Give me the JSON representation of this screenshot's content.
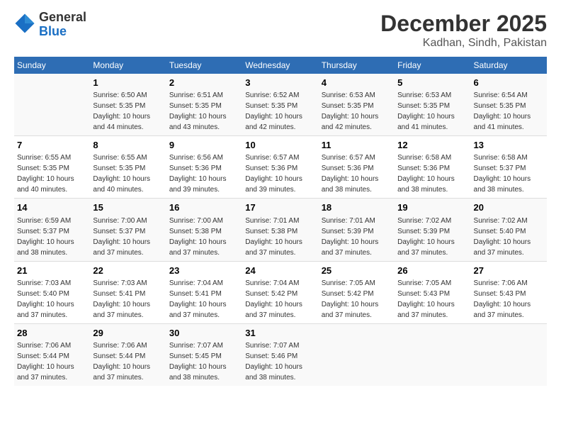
{
  "logo": {
    "general": "General",
    "blue": "Blue"
  },
  "title": "December 2025",
  "subtitle": "Kadhan, Sindh, Pakistan",
  "weekdays": [
    "Sunday",
    "Monday",
    "Tuesday",
    "Wednesday",
    "Thursday",
    "Friday",
    "Saturday"
  ],
  "weeks": [
    [
      {
        "day": "",
        "sunrise": "",
        "sunset": "",
        "daylight": ""
      },
      {
        "day": "1",
        "sunrise": "Sunrise: 6:50 AM",
        "sunset": "Sunset: 5:35 PM",
        "daylight": "Daylight: 10 hours and 44 minutes."
      },
      {
        "day": "2",
        "sunrise": "Sunrise: 6:51 AM",
        "sunset": "Sunset: 5:35 PM",
        "daylight": "Daylight: 10 hours and 43 minutes."
      },
      {
        "day": "3",
        "sunrise": "Sunrise: 6:52 AM",
        "sunset": "Sunset: 5:35 PM",
        "daylight": "Daylight: 10 hours and 42 minutes."
      },
      {
        "day": "4",
        "sunrise": "Sunrise: 6:53 AM",
        "sunset": "Sunset: 5:35 PM",
        "daylight": "Daylight: 10 hours and 42 minutes."
      },
      {
        "day": "5",
        "sunrise": "Sunrise: 6:53 AM",
        "sunset": "Sunset: 5:35 PM",
        "daylight": "Daylight: 10 hours and 41 minutes."
      },
      {
        "day": "6",
        "sunrise": "Sunrise: 6:54 AM",
        "sunset": "Sunset: 5:35 PM",
        "daylight": "Daylight: 10 hours and 41 minutes."
      }
    ],
    [
      {
        "day": "7",
        "sunrise": "Sunrise: 6:55 AM",
        "sunset": "Sunset: 5:35 PM",
        "daylight": "Daylight: 10 hours and 40 minutes."
      },
      {
        "day": "8",
        "sunrise": "Sunrise: 6:55 AM",
        "sunset": "Sunset: 5:35 PM",
        "daylight": "Daylight: 10 hours and 40 minutes."
      },
      {
        "day": "9",
        "sunrise": "Sunrise: 6:56 AM",
        "sunset": "Sunset: 5:36 PM",
        "daylight": "Daylight: 10 hours and 39 minutes."
      },
      {
        "day": "10",
        "sunrise": "Sunrise: 6:57 AM",
        "sunset": "Sunset: 5:36 PM",
        "daylight": "Daylight: 10 hours and 39 minutes."
      },
      {
        "day": "11",
        "sunrise": "Sunrise: 6:57 AM",
        "sunset": "Sunset: 5:36 PM",
        "daylight": "Daylight: 10 hours and 38 minutes."
      },
      {
        "day": "12",
        "sunrise": "Sunrise: 6:58 AM",
        "sunset": "Sunset: 5:36 PM",
        "daylight": "Daylight: 10 hours and 38 minutes."
      },
      {
        "day": "13",
        "sunrise": "Sunrise: 6:58 AM",
        "sunset": "Sunset: 5:37 PM",
        "daylight": "Daylight: 10 hours and 38 minutes."
      }
    ],
    [
      {
        "day": "14",
        "sunrise": "Sunrise: 6:59 AM",
        "sunset": "Sunset: 5:37 PM",
        "daylight": "Daylight: 10 hours and 38 minutes."
      },
      {
        "day": "15",
        "sunrise": "Sunrise: 7:00 AM",
        "sunset": "Sunset: 5:37 PM",
        "daylight": "Daylight: 10 hours and 37 minutes."
      },
      {
        "day": "16",
        "sunrise": "Sunrise: 7:00 AM",
        "sunset": "Sunset: 5:38 PM",
        "daylight": "Daylight: 10 hours and 37 minutes."
      },
      {
        "day": "17",
        "sunrise": "Sunrise: 7:01 AM",
        "sunset": "Sunset: 5:38 PM",
        "daylight": "Daylight: 10 hours and 37 minutes."
      },
      {
        "day": "18",
        "sunrise": "Sunrise: 7:01 AM",
        "sunset": "Sunset: 5:39 PM",
        "daylight": "Daylight: 10 hours and 37 minutes."
      },
      {
        "day": "19",
        "sunrise": "Sunrise: 7:02 AM",
        "sunset": "Sunset: 5:39 PM",
        "daylight": "Daylight: 10 hours and 37 minutes."
      },
      {
        "day": "20",
        "sunrise": "Sunrise: 7:02 AM",
        "sunset": "Sunset: 5:40 PM",
        "daylight": "Daylight: 10 hours and 37 minutes."
      }
    ],
    [
      {
        "day": "21",
        "sunrise": "Sunrise: 7:03 AM",
        "sunset": "Sunset: 5:40 PM",
        "daylight": "Daylight: 10 hours and 37 minutes."
      },
      {
        "day": "22",
        "sunrise": "Sunrise: 7:03 AM",
        "sunset": "Sunset: 5:41 PM",
        "daylight": "Daylight: 10 hours and 37 minutes."
      },
      {
        "day": "23",
        "sunrise": "Sunrise: 7:04 AM",
        "sunset": "Sunset: 5:41 PM",
        "daylight": "Daylight: 10 hours and 37 minutes."
      },
      {
        "day": "24",
        "sunrise": "Sunrise: 7:04 AM",
        "sunset": "Sunset: 5:42 PM",
        "daylight": "Daylight: 10 hours and 37 minutes."
      },
      {
        "day": "25",
        "sunrise": "Sunrise: 7:05 AM",
        "sunset": "Sunset: 5:42 PM",
        "daylight": "Daylight: 10 hours and 37 minutes."
      },
      {
        "day": "26",
        "sunrise": "Sunrise: 7:05 AM",
        "sunset": "Sunset: 5:43 PM",
        "daylight": "Daylight: 10 hours and 37 minutes."
      },
      {
        "day": "27",
        "sunrise": "Sunrise: 7:06 AM",
        "sunset": "Sunset: 5:43 PM",
        "daylight": "Daylight: 10 hours and 37 minutes."
      }
    ],
    [
      {
        "day": "28",
        "sunrise": "Sunrise: 7:06 AM",
        "sunset": "Sunset: 5:44 PM",
        "daylight": "Daylight: 10 hours and 37 minutes."
      },
      {
        "day": "29",
        "sunrise": "Sunrise: 7:06 AM",
        "sunset": "Sunset: 5:44 PM",
        "daylight": "Daylight: 10 hours and 37 minutes."
      },
      {
        "day": "30",
        "sunrise": "Sunrise: 7:07 AM",
        "sunset": "Sunset: 5:45 PM",
        "daylight": "Daylight: 10 hours and 38 minutes."
      },
      {
        "day": "31",
        "sunrise": "Sunrise: 7:07 AM",
        "sunset": "Sunset: 5:46 PM",
        "daylight": "Daylight: 10 hours and 38 minutes."
      },
      {
        "day": "",
        "sunrise": "",
        "sunset": "",
        "daylight": ""
      },
      {
        "day": "",
        "sunrise": "",
        "sunset": "",
        "daylight": ""
      },
      {
        "day": "",
        "sunrise": "",
        "sunset": "",
        "daylight": ""
      }
    ]
  ]
}
